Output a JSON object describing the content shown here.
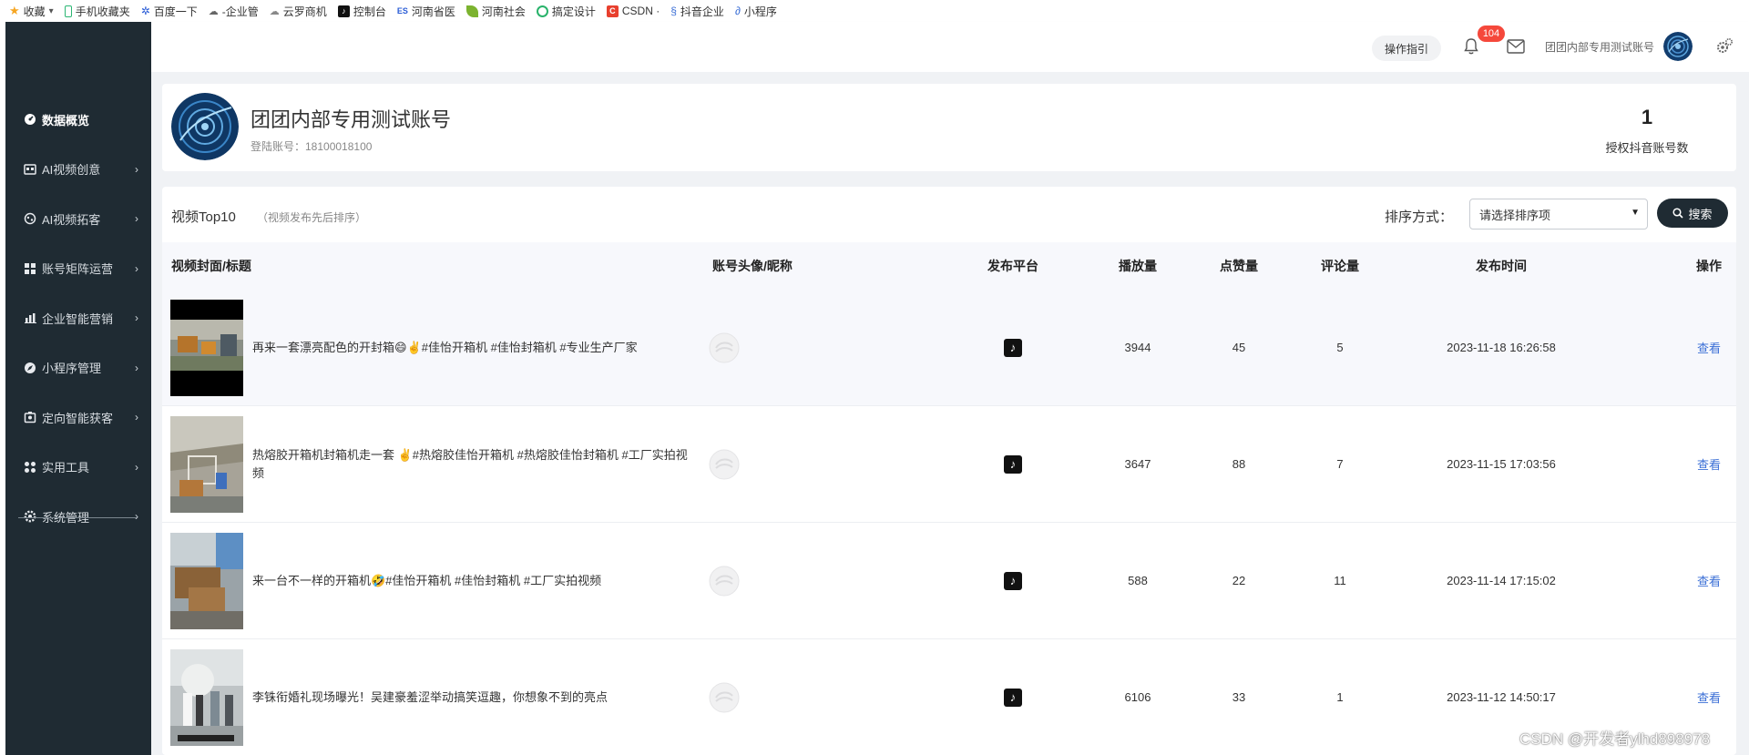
{
  "bookmarks": [
    {
      "label": "收藏",
      "icon": "star-icon",
      "color": "#f6a623"
    },
    {
      "label": "手机收藏夹",
      "icon": "phone-icon",
      "color": "#2bb673"
    },
    {
      "label": "百度一下",
      "icon": "baidu-paw-icon",
      "color": "#2a5cd6"
    },
    {
      "label": "-企业管",
      "icon": "cloud-icon",
      "color": "#666666"
    },
    {
      "label": "云罗商机",
      "icon": "cloud-icon",
      "color": "#888888"
    },
    {
      "label": "控制台",
      "icon": "tiktok-icon",
      "color": "#111111"
    },
    {
      "label": "河南省医",
      "icon": "site-icon",
      "color": "#2a5cd6"
    },
    {
      "label": "河南社会",
      "icon": "leaf-icon",
      "color": "#7cb32f"
    },
    {
      "label": "搞定设计",
      "icon": "ring-icon",
      "color": "#29b36b"
    },
    {
      "label": "CSDN ·",
      "icon": "csdn-icon",
      "color": "#e8402e"
    },
    {
      "label": "抖音企业",
      "icon": "douyin-icon",
      "color": "#3b6fd6"
    },
    {
      "label": "小程序",
      "icon": "link-icon",
      "color": "#3b6fd6"
    }
  ],
  "sidebar": {
    "items": [
      {
        "label": "数据概览",
        "icon": "dashboard-icon",
        "active": true
      },
      {
        "label": "AI视频创意",
        "icon": "video-icon"
      },
      {
        "label": "AI视频拓客",
        "icon": "globe-icon"
      },
      {
        "label": "账号矩阵运营",
        "icon": "grid-icon"
      },
      {
        "label": "企业智能营销",
        "icon": "bar-chart-icon"
      },
      {
        "label": "小程序管理",
        "icon": "compass-icon"
      },
      {
        "label": "定向智能获客",
        "icon": "target-icon"
      },
      {
        "label": "实用工具",
        "icon": "tools-icon"
      },
      {
        "label": "系统管理",
        "icon": "settings-icon"
      }
    ],
    "arrow": "›"
  },
  "header": {
    "guide_label": "操作指引",
    "notification_count": "104",
    "account_name": "团团内部专用测试账号"
  },
  "account_card": {
    "title": "团团内部专用测试账号",
    "login": "登陆账号：18100018100",
    "authorized_count": "1",
    "authorized_label": "授权抖音账号数"
  },
  "videos": {
    "title": "视频Top10",
    "subtitle": "（视频发布先后排序）",
    "sort_label": "排序方式：",
    "sort_placeholder": "请选择排序项",
    "search_label": "搜索",
    "columns": [
      "视频封面/标题",
      "账号头像/昵称",
      "发布平台",
      "播放量",
      "点赞量",
      "评论量",
      "发布时间",
      "操作"
    ],
    "rows": [
      {
        "title": "再来一套漂亮配色的开封箱😄✌️#佳怡开箱机 #佳怡封箱机 #专业生产厂家",
        "platform": "tiktok-icon",
        "plays": "3944",
        "likes": "45",
        "comments": "5",
        "time": "2023-11-18 16:26:58",
        "action": "查看"
      },
      {
        "title": "热熔胶开箱机封箱机走一套 ✌️#热熔胶佳怡开箱机 #热熔胶佳怡封箱机 #工厂实拍视频",
        "platform": "tiktok-icon",
        "plays": "3647",
        "likes": "88",
        "comments": "7",
        "time": "2023-11-15 17:03:56",
        "action": "查看"
      },
      {
        "title": "来一台不一样的开箱机🤣#佳怡开箱机 #佳怡封箱机 #工厂实拍视频",
        "platform": "tiktok-icon",
        "plays": "588",
        "likes": "22",
        "comments": "11",
        "time": "2023-11-14 17:15:02",
        "action": "查看"
      },
      {
        "title": "李铢衔婚礼现场曝光！吴建豪羞涩举动搞笑逗趣，你想象不到的亮点",
        "platform": "tiktok-icon",
        "plays": "6106",
        "likes": "33",
        "comments": "1",
        "time": "2023-11-12 14:50:17",
        "action": "查看"
      }
    ]
  },
  "watermark": "CSDN @开发者ylhd898978",
  "colors": {
    "sidebar_bg": "#1f2b33",
    "accent_link": "#3b6fd6",
    "badge": "#f5483b",
    "table_head_bg": "#f7f8fc"
  }
}
